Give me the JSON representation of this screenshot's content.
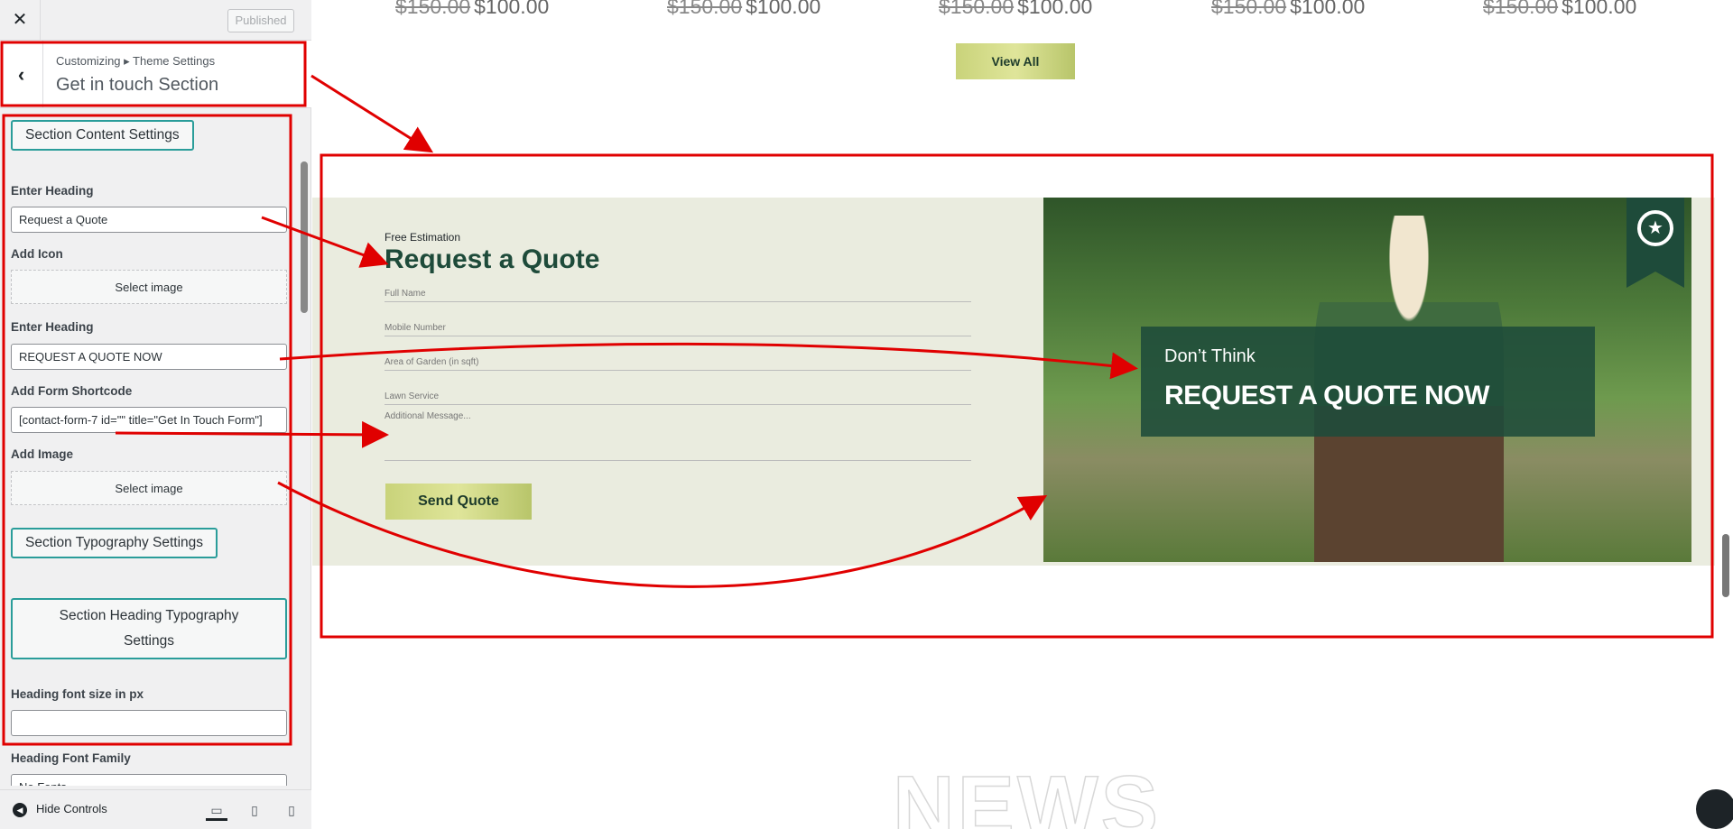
{
  "sidebar": {
    "close_icon": "close-icon",
    "published_label": "Published",
    "breadcrumb": "Customizing ▸ Theme Settings",
    "title": "Get in touch Section",
    "section_content_label": "Section Content Settings",
    "heading1_label": "Enter Heading",
    "heading1_value": "Request a Quote",
    "icon_label": "Add Icon",
    "select_image_1": "Select image",
    "heading2_label": "Enter Heading",
    "heading2_value": "REQUEST A QUOTE NOW",
    "shortcode_label": "Add Form Shortcode",
    "shortcode_value": "[contact-form-7 id=\"\" title=\"Get In Touch Form\"]",
    "image_label": "Add Image",
    "select_image_2": "Select image",
    "typography_label": "Section Typography Settings",
    "heading_typo_label": "Section Heading Typography Settings",
    "font_size_label": "Heading font size in px",
    "font_size_value": "",
    "font_family_label": "Heading Font Family",
    "font_family_value": "No Fonts",
    "hide_controls": "Hide Controls"
  },
  "preview": {
    "old_price": "$150.00",
    "new_price": "$100.00",
    "view_all": "View All",
    "free_estimation": "Free Estimation",
    "heading": "Request a Quote",
    "fields": [
      "Full Name",
      "Mobile Number",
      "Area of Garden (in sqft)",
      "Lawn Service",
      "Additional Message..."
    ],
    "send_button": "Send Quote",
    "dont_think": "Don’t Think",
    "request_now": "REQUEST A QUOTE NOW",
    "news": "NEWS"
  },
  "colors": {
    "annotation": "#e00000",
    "accent": "#1e4b3a",
    "teal_border": "#2a9d9a"
  }
}
